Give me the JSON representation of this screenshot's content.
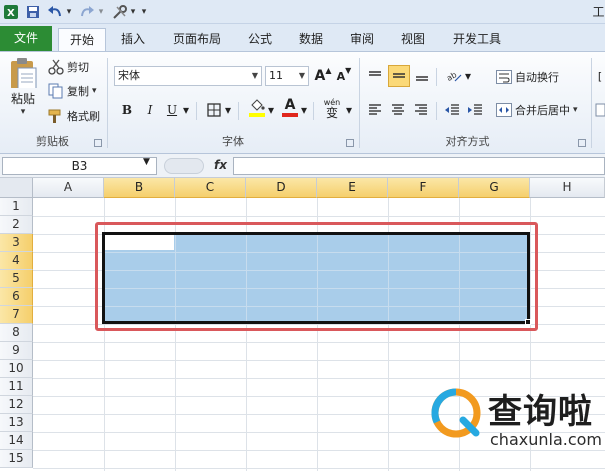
{
  "quick_access": {
    "icons": [
      "save-icon",
      "undo-icon",
      "redo-icon",
      "tools-icon",
      "customize-icon"
    ],
    "right_fragment": "工"
  },
  "tabs": [
    {
      "label": "文件"
    },
    {
      "label": "开始"
    },
    {
      "label": "插入"
    },
    {
      "label": "页面布局"
    },
    {
      "label": "公式"
    },
    {
      "label": "数据"
    },
    {
      "label": "审阅"
    },
    {
      "label": "视图"
    },
    {
      "label": "开发工具"
    }
  ],
  "ribbon": {
    "clipboard": {
      "paste_label": "粘贴",
      "cut_label": "剪切",
      "copy_label": "复制",
      "format_painter_label": "格式刷",
      "group_label": "剪贴板"
    },
    "font": {
      "font_name": "宋体",
      "font_size": "11",
      "grow_glyph": "A",
      "shrink_glyph": "A",
      "bold": "B",
      "italic": "I",
      "underline": "U",
      "font_color_glyph": "A",
      "phonetic_glyph": "wén",
      "phonetic_char": "变",
      "group_label": "字体"
    },
    "alignment": {
      "wrap_text_label": "自动换行",
      "merge_center_label": "合并后居中",
      "group_label": "对齐方式"
    }
  },
  "formula_bar": {
    "name_box": "B3",
    "fx_label": "fx",
    "formula": ""
  },
  "sheet": {
    "columns": [
      "A",
      "B",
      "C",
      "D",
      "E",
      "F",
      "G",
      "H"
    ],
    "rows": [
      "1",
      "2",
      "3",
      "4",
      "5",
      "6",
      "7",
      "8",
      "9",
      "10",
      "11",
      "12",
      "13",
      "14",
      "15"
    ],
    "selected_range": "B3:G7",
    "active_cell": "B3",
    "selection_color": "#a9cdea",
    "highlight_color": "#d9585b"
  },
  "watermark": {
    "title": "查询啦",
    "domain": "chaxunla.com"
  }
}
